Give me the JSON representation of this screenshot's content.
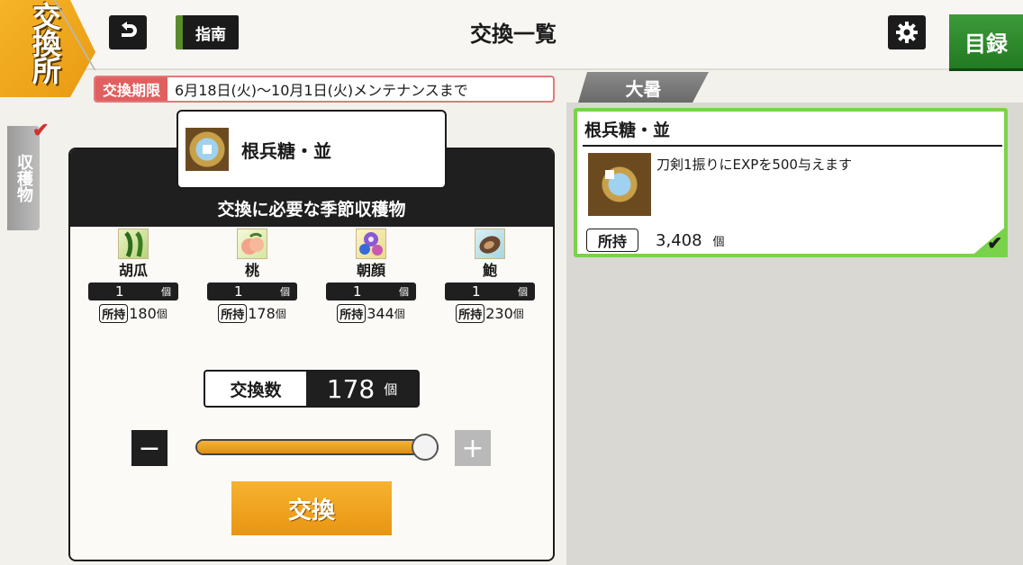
{
  "header": {
    "shop_badge": "交換所",
    "guide_label": "指南",
    "title": "交換一覧",
    "catalog_label": "目録"
  },
  "period": {
    "label": "交換期限",
    "value": "6月18日(火)〜10月1日(火)メンテナンスまで"
  },
  "season_tab": "大暑",
  "side_tab": "収穫物",
  "exchange": {
    "target_name": "根兵糖・並",
    "subtitle": "交換に必要な季節収穫物",
    "materials": [
      {
        "name": "胡瓜",
        "required": "1",
        "unit": "個",
        "owned_label": "所持",
        "owned": "180",
        "owned_unit": "個",
        "icon": "cucumber-icon"
      },
      {
        "name": "桃",
        "required": "1",
        "unit": "個",
        "owned_label": "所持",
        "owned": "178",
        "owned_unit": "個",
        "icon": "peach-icon"
      },
      {
        "name": "朝顔",
        "required": "1",
        "unit": "個",
        "owned_label": "所持",
        "owned": "344",
        "owned_unit": "個",
        "icon": "morning-glory-icon"
      },
      {
        "name": "鮑",
        "required": "1",
        "unit": "個",
        "owned_label": "所持",
        "owned": "230",
        "owned_unit": "個",
        "icon": "abalone-icon"
      }
    ],
    "count_label": "交換数",
    "count_value": "178",
    "count_unit": "個",
    "slider_fraction": 1.0,
    "button_label": "交換"
  },
  "list": {
    "items": [
      {
        "title": "根兵糖・並",
        "description": "刀剣1振りにEXPを500与えます",
        "owned_label": "所持",
        "owned": "3,408",
        "owned_unit": "個",
        "selected": true
      }
    ]
  },
  "colors": {
    "accent_orange": "#f0a020",
    "selected_green": "#7ad24a",
    "period_red": "#e05f5f"
  }
}
